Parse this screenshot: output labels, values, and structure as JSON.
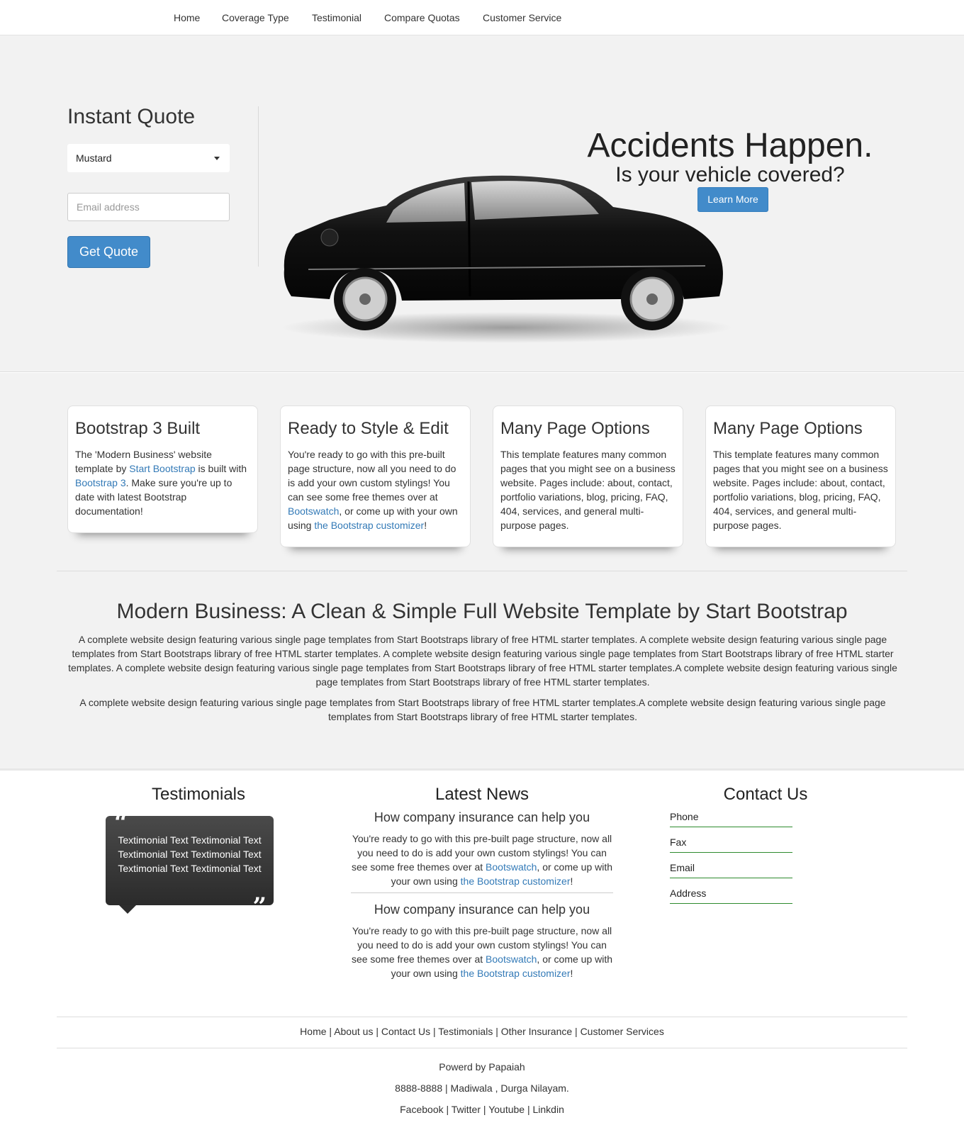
{
  "nav": {
    "items": [
      "Home",
      "Coverage Type",
      "Testimonial",
      "Compare Quotas",
      "Customer Service"
    ]
  },
  "hero": {
    "quote_title": "Instant Quote",
    "select_value": "Mustard",
    "email_placeholder": "Email address",
    "get_quote_label": "Get Quote",
    "headline": "Accidents Happen.",
    "subheadline": "Is your vehicle covered?",
    "learn_more_label": "Learn More"
  },
  "features": {
    "cards": [
      {
        "title": "Bootstrap 3 Built",
        "text_1": "The 'Modern Business' website template by ",
        "link_1": "Start Bootstrap",
        "text_2": " is built with ",
        "link_2": "Bootstrap 3",
        "text_3": ". Make sure you're up to date with latest Bootstrap documentation!"
      },
      {
        "title": "Ready to Style & Edit",
        "text_1": "You're ready to go with this pre-built page structure, now all you need to do is add your own custom stylings! You can see some free themes over at ",
        "link_1": "Bootswatch",
        "text_2": ", or come up with your own using ",
        "link_2": "the Bootstrap customizer",
        "text_3": "!"
      },
      {
        "title": "Many Page Options",
        "text": "This template features many common pages that you might see on a business website. Pages include: about, contact, portfolio variations, blog, pricing, FAQ, 404, services, and general multi-purpose pages."
      },
      {
        "title": "Many Page Options",
        "text": "This template features many common pages that you might see on a business website. Pages include: about, contact, portfolio variations, blog, pricing, FAQ, 404, services, and general multi-purpose pages."
      }
    ],
    "intro_title": "Modern Business: A Clean & Simple Full Website Template by Start Bootstrap",
    "intro_p1": "A complete website design featuring various single page templates from Start Bootstraps library of free HTML starter templates. A complete website design featuring various single page templates from Start Bootstraps library of free HTML starter templates. A complete website design featuring various single page templates from Start Bootstraps library of free HTML starter templates. A complete website design featuring various single page templates from Start Bootstraps library of free HTML starter templates.A complete website design featuring various single page templates from Start Bootstraps library of free HTML starter templates.",
    "intro_p2": "A complete website design featuring various single page templates from Start Bootstraps library of free HTML starter templates.A complete website design featuring various single page templates from Start Bootstraps library of free HTML starter templates."
  },
  "testimonials": {
    "title": "Testimonials",
    "text": "Textimonial Text Textimonial Text Textimonial Text Textimonial Text Textimonial Text Textimonial Text"
  },
  "news": {
    "title": "Latest News",
    "items": [
      {
        "heading": "How company insurance can help you",
        "text_1": "You're ready to go with this pre-built page structure, now all you need to do is add your own custom stylings! You can see some free themes over at ",
        "link_1": "Bootswatch",
        "text_2": ", or come up with your own using ",
        "link_2": "the Bootstrap customizer",
        "text_3": "!"
      },
      {
        "heading": "How company insurance can help you",
        "text_1": "You're ready to go with this pre-built page structure, now all you need to do is add your own custom stylings! You can see some free themes over at ",
        "link_1": "Bootswatch",
        "text_2": ", or come up with your own using ",
        "link_2": "the Bootstrap customizer",
        "text_3": "!"
      }
    ]
  },
  "contact": {
    "title": "Contact Us",
    "items": [
      "Phone",
      "Fax",
      "Email",
      "Address"
    ]
  },
  "footer": {
    "links": [
      "Home",
      "About us",
      "Contact Us",
      "Testimonials",
      "Other Insurance",
      "Customer Services"
    ],
    "separator": " | ",
    "powered": "Powerd by Papaiah",
    "address": "8888-8888 | Madiwala , Durga Nilayam.",
    "social": [
      "Facebook",
      "Twitter",
      "Youtube",
      "Linkdin"
    ]
  },
  "colors": {
    "primary": "#428bca",
    "link": "#337ab7",
    "background": "#f2f2f2",
    "contact_underline": "#2e8b2e"
  }
}
